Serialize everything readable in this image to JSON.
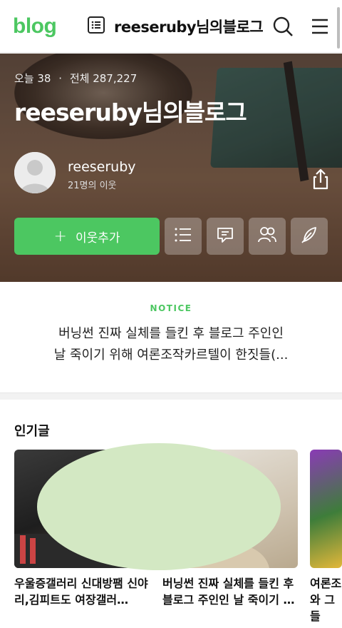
{
  "header": {
    "logo": "blog",
    "title": "reeseruby님의블로그"
  },
  "hero": {
    "today_label": "오늘",
    "today_count": "38",
    "separator": "·",
    "total_label": "전체",
    "total_count": "287,227",
    "blog_title": "reeseruby님의블로그",
    "user_name": "reeseruby",
    "neighbors": "21명의 이웃",
    "add_neighbor_label": "이웃추가"
  },
  "notice": {
    "label": "NOTICE",
    "line1": "버닝썬 진짜 실체를 들킨 후 블로그 주인인",
    "line2": "날 죽이기 위해 여론조작카르텔이 한짓들(..."
  },
  "popular": {
    "header": "인기글",
    "cards": [
      {
        "caption": "우울증갤러리 신대방팸 신야리,김피트도 여장갤러…"
      },
      {
        "caption": "버닝썬 진짜 실체를 들킨 후 블로그 주인인 날 죽이기 …"
      },
      {
        "caption": "여론조와 그들"
      }
    ]
  },
  "colors": {
    "brand_green": "#4cc761",
    "redaction": "#d3e8c3"
  }
}
